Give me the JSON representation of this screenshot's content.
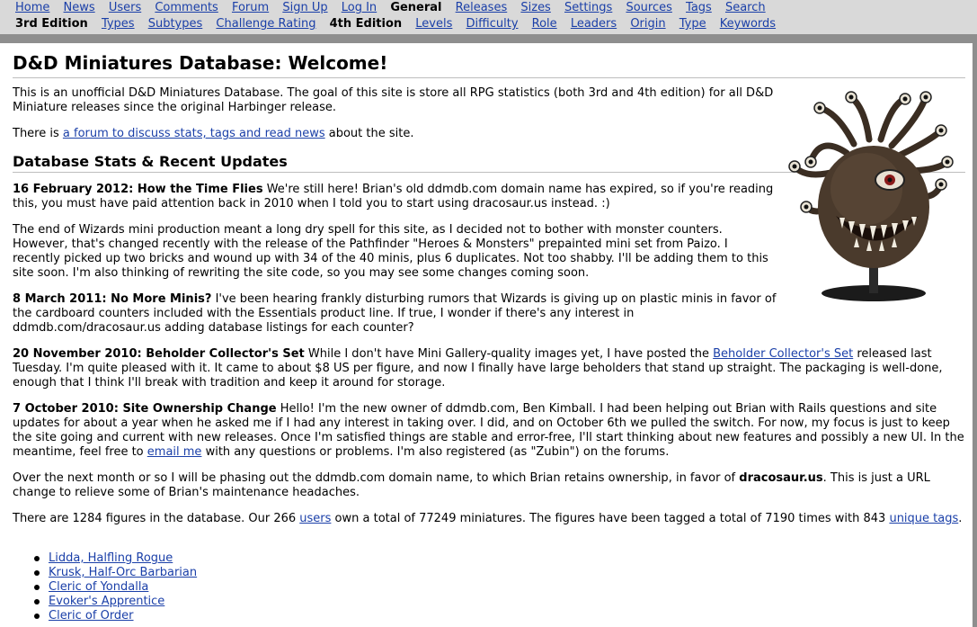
{
  "nav": {
    "row1_label": "",
    "row1": [
      "Home",
      "News",
      "Users",
      "Comments",
      "Forum",
      "Sign Up",
      "Log In"
    ],
    "general_label": "General",
    "general": [
      "Releases",
      "Sizes",
      "Settings",
      "Sources",
      "Tags",
      "Search"
    ],
    "third_label": "3rd Edition",
    "third": [
      "Types",
      "Subtypes",
      "Challenge Rating"
    ],
    "fourth_label": "4th Edition",
    "fourth": [
      "Levels",
      "Difficulty",
      "Role",
      "Leaders",
      "Origin",
      "Type",
      "Keywords"
    ]
  },
  "page_title": "D&D Miniatures Database: Welcome!",
  "intro": "This is an unofficial D&D Miniatures Database. The goal of this site is store all RPG statistics (both 3rd and 4th edition) for all D&D Miniature releases since the original Harbinger release.",
  "forum_pre": "There is ",
  "forum_link": "a forum to discuss stats, tags and read news",
  "forum_post": " about the site.",
  "section_title": "Database Stats & Recent Updates",
  "news": [
    {
      "title": "16 February 2012: How the Time Flies",
      "body": " We're still here! Brian's old ddmdb.com domain name has expired, so if you're reading this, you must have paid attention back in 2010 when I told you to start using dracosaur.us instead. :)"
    },
    {
      "title": "",
      "body": "The end of Wizards mini production meant a long dry spell for this site, as I decided not to bother with monster counters. However, that's changed recently with the release of the Pathfinder \"Heroes & Monsters\" prepainted mini set from Paizo. I recently picked up two bricks and wound up with 34 of the 40 minis, plus 6 duplicates. Not too shabby. I'll be adding them to this site soon. I'm also thinking of rewriting the site code, so you may see some changes coming soon."
    },
    {
      "title": "8 March 2011: No More Minis?",
      "body": " I've been hearing frankly disturbing rumors that Wizards is giving up on plastic minis in favor of the cardboard counters included with the Essentials product line. If true, I wonder if there's any interest in ddmdb.com/dracosaur.us adding database listings for each counter?"
    },
    {
      "title": "20 November 2010: Beholder Collector's Set",
      "body_pre": " While I don't have Mini Gallery-quality images yet, I have posted the ",
      "link": "Beholder Collector's Set",
      "body_post": " released last Tuesday. I'm quite pleased with it. It came to about $8 US per figure, and now I finally have large beholders that stand up straight. The packaging is well-done, enough that I think I'll break with tradition and keep it around for storage."
    },
    {
      "title": "7 October 2010: Site Ownership Change",
      "body_pre": " Hello! I'm the new owner of ddmdb.com, Ben Kimball. I had been helping out Brian with Rails questions and site updates for about a year when he asked me if I had any interest in taking over. I did, and on October 6th we pulled the switch. For now, my focus is just to keep the site going and current with new releases. Once I'm satisfied things are stable and error-free, I'll start thinking about new features and possibly a new UI. In the meantime, feel free to ",
      "link": "email me",
      "body_post": " with any questions or problems. I'm also registered (as \"Zubin\") on the forums."
    }
  ],
  "domain_note_pre": "Over the next month or so I will be phasing out the ddmdb.com domain name, to which Brian retains ownership, in favor of ",
  "domain_note_bold": "dracosaur.us",
  "domain_note_post": ". This is just a URL change to relieve some of Brian's maintenance headaches.",
  "stats": {
    "pre": "There are 1284 figures in the database. Our 266 ",
    "users_link": "users",
    "mid": " own a total of 77249 miniatures. The figures have been tagged a total of 7190 times with 843 ",
    "tags_link": "unique tags",
    "post": "."
  },
  "figures": [
    "Lidda, Halfling Rogue",
    "Krusk, Half-Orc Barbarian",
    "Cleric of Yondalla",
    "Evoker's Apprentice",
    "Cleric of Order"
  ],
  "colors": {
    "link": "#1a3fa8",
    "nav_bg": "#d9d9d9",
    "bar": "#8e8e8e"
  }
}
